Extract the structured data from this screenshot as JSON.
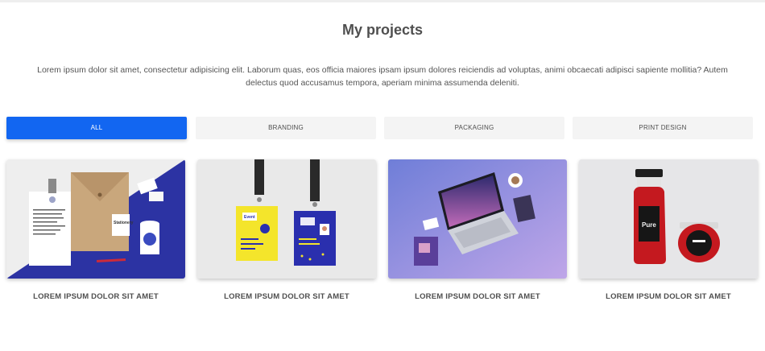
{
  "header": {
    "title": "My projects"
  },
  "intro": {
    "text": "Lorem ipsum dolor sit amet, consectetur adipisicing elit. Laborum quas, eos officia maiores ipsam ipsum dolores reiciendis ad voluptas, animi obcaecati adipisci sapiente mollitia? Autem delectus quod accusamus tempora, aperiam minima assumenda deleniti."
  },
  "filters": [
    {
      "label": "ALL",
      "active": true
    },
    {
      "label": "BRANDING",
      "active": false
    },
    {
      "label": "PACKAGING",
      "active": false
    },
    {
      "label": "PRINT DESIGN",
      "active": false
    }
  ],
  "colors": {
    "accent": "#1266f1",
    "filter_bg": "#f4f4f4"
  },
  "projects": [
    {
      "image": "stationery-mockup",
      "caption": "LOREM IPSUM DOLOR SIT AMET",
      "mock_text": "Stationery"
    },
    {
      "image": "id-badges-mockup",
      "caption": "LOREM IPSUM DOLOR SIT AMET",
      "mock_text": "Event"
    },
    {
      "image": "laptop-mockup",
      "caption": "LOREM IPSUM DOLOR SIT AMET"
    },
    {
      "image": "bottle-jar-mockup",
      "caption": "LOREM IPSUM DOLOR SIT AMET",
      "mock_text": "Pure"
    }
  ]
}
